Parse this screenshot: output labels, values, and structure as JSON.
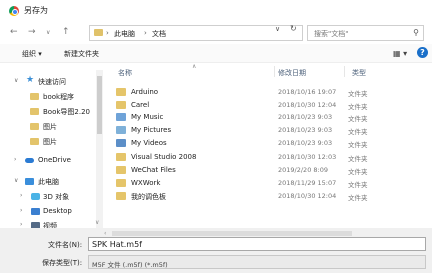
{
  "window": {
    "title": "另存为"
  },
  "address": {
    "crumb1": "此电脑",
    "crumb2": "文档",
    "sep": "›"
  },
  "search": {
    "placeholder": "搜索\"文档\""
  },
  "toolbar": {
    "organize": "组织 ▾",
    "new_folder": "新建文件夹",
    "view": "▦ ▾",
    "help": "?"
  },
  "sidebar": {
    "items": [
      {
        "label": "快速访问",
        "chev": "∨"
      },
      {
        "label": "book程序"
      },
      {
        "label": "Book导图2.20"
      },
      {
        "label": "图片"
      },
      {
        "label": "图片"
      },
      {
        "label": "OneDrive",
        "chev": "›"
      },
      {
        "label": "此电脑",
        "chev": "∨"
      },
      {
        "label": "3D 对象",
        "chev": "›"
      },
      {
        "label": "Desktop",
        "chev": "›"
      },
      {
        "label": "视频",
        "chev": "›"
      }
    ]
  },
  "columns": {
    "name": "名称",
    "date": "修改日期",
    "type": "类型"
  },
  "files": [
    {
      "name": "Arduino",
      "date": "2018/10/16 19:07",
      "type": "文件夹",
      "icon": "folder-icon"
    },
    {
      "name": "Carel",
      "date": "2018/10/30 12:04",
      "type": "文件夹",
      "icon": "folder-icon"
    },
    {
      "name": "My Music",
      "date": "2018/10/23 9:03",
      "type": "文件夹",
      "icon": "music-folder-icon"
    },
    {
      "name": "My Pictures",
      "date": "2018/10/23 9:03",
      "type": "文件夹",
      "icon": "pictures-folder-icon"
    },
    {
      "name": "My Videos",
      "date": "2018/10/23 9:03",
      "type": "文件夹",
      "icon": "videos-folder-icon"
    },
    {
      "name": "Visual Studio 2008",
      "date": "2018/10/30 12:03",
      "type": "文件夹",
      "icon": "folder-icon"
    },
    {
      "name": "WeChat Files",
      "date": "2019/2/20 8:09",
      "type": "文件夹",
      "icon": "folder-icon"
    },
    {
      "name": "WXWork",
      "date": "2018/11/29 15:07",
      "type": "文件夹",
      "icon": "folder-icon"
    },
    {
      "name": "我的调色板",
      "date": "2018/10/30 12:04",
      "type": "文件夹",
      "icon": "folder-icon"
    }
  ],
  "form": {
    "filename_label": "文件名(N):",
    "filename_value": "SPK Hat.m5f",
    "filetype_label": "保存类型(T):",
    "filetype_value": "M5F 文件 (.m5f) (*.m5f)"
  }
}
